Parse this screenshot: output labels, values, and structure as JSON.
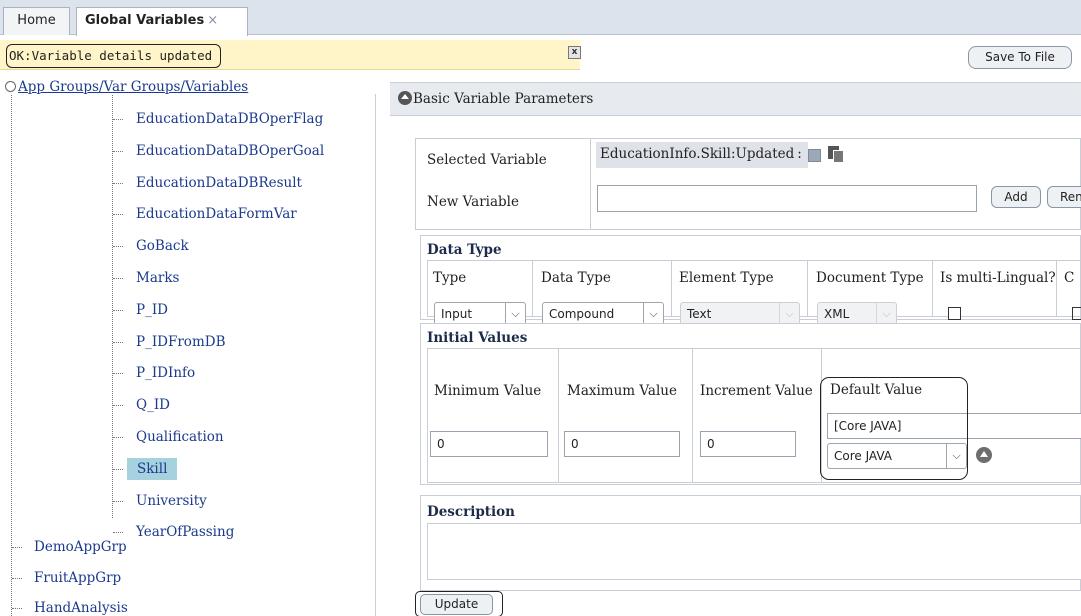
{
  "tabs": {
    "home": "Home",
    "global_variables": "Global Variables",
    "close_symbol": "×"
  },
  "status": {
    "message": "OK:Variable details updated",
    "close_symbol": "x"
  },
  "toolbar": {
    "save_to_file": "Save To File"
  },
  "tree": {
    "root": "App Groups/Var Groups/Variables",
    "children": [
      "EducationDataDBOperFlag",
      "EducationDataDBOperGoal",
      "EducationDataDBResult",
      "EducationDataFormVar",
      "GoBack",
      "Marks",
      "P_ID",
      "P_IDFromDB",
      "P_IDInfo",
      "Q_ID",
      "Qualification",
      "Skill",
      "University",
      "YearOfPassing"
    ],
    "selected": "Skill",
    "app_groups": [
      "DemoAppGrp",
      "FruitAppGrp",
      "HandAnalysis"
    ]
  },
  "basic": {
    "header": "Basic Variable Parameters",
    "selected_variable_label": "Selected Variable",
    "selected_variable_value": "EducationInfo.Skill:Updated",
    "selected_variable_sep": ":",
    "new_variable_label": "New Variable",
    "new_variable_value": "",
    "add_button": "Add",
    "rename_button_partial": "Ren"
  },
  "data_type": {
    "header": "Data Type",
    "columns": {
      "type": "Type",
      "data_type": "Data Type",
      "element_type": "Element Type",
      "document_type": "Document Type",
      "multilingual": "Is multi-Lingual?",
      "partial": "C"
    },
    "values": {
      "type": "Input",
      "data_type": "Compound",
      "element_type": "Text",
      "document_type": "XML",
      "multilingual": false
    }
  },
  "initial_values": {
    "header": "Initial Values",
    "min_label": "Minimum Value",
    "max_label": "Maximum Value",
    "inc_label": "Increment Value",
    "default_label": "Default Value",
    "min_value": "0",
    "max_value": "0",
    "inc_value": "0",
    "default_text": "[Core JAVA]",
    "default_select": "Core JAVA"
  },
  "description": {
    "header": "Description",
    "value": ""
  },
  "actions": {
    "update": "Update"
  },
  "icons": {
    "dropdown": "⌵"
  }
}
